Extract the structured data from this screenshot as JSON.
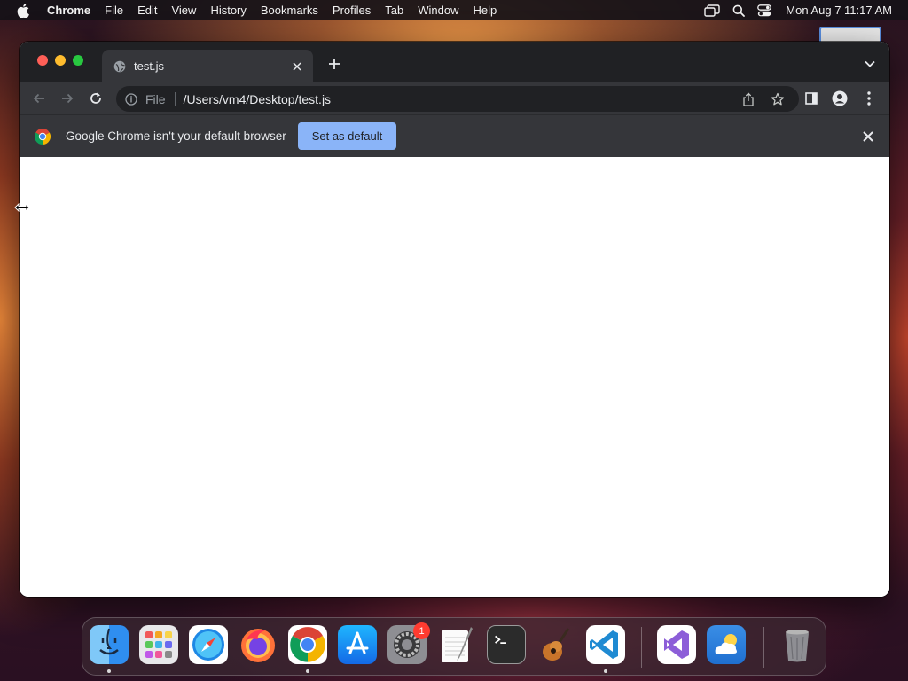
{
  "menubar": {
    "apple_icon": "apple-logo-icon",
    "items": [
      "Chrome",
      "File",
      "Edit",
      "View",
      "History",
      "Bookmarks",
      "Profiles",
      "Tab",
      "Window",
      "Help"
    ],
    "right_icons": [
      "screen-mirroring-icon",
      "search-icon",
      "control-center-icon"
    ],
    "clock": "Mon Aug 7  11:17 AM"
  },
  "browser": {
    "tab": {
      "title": "test.js",
      "favicon": "globe-icon"
    },
    "omnibox": {
      "scheme": "File",
      "url": "/Users/vm4/Desktop/test.js"
    },
    "infobar": {
      "message": "Google Chrome isn't your default browser",
      "button_label": "Set as default"
    },
    "colors": {
      "titlebar": "#202124",
      "toolbar": "#35363a",
      "accent_button": "#8ab4f8",
      "content": "#ffffff"
    }
  },
  "dock": {
    "apps": [
      {
        "name": "Finder",
        "icon": "finder-icon",
        "running": true
      },
      {
        "name": "Launchpad",
        "icon": "launchpad-icon",
        "running": false
      },
      {
        "name": "Safari",
        "icon": "safari-icon",
        "running": false
      },
      {
        "name": "Firefox",
        "icon": "firefox-icon",
        "running": false
      },
      {
        "name": "Google Chrome",
        "icon": "chrome-icon",
        "running": true
      },
      {
        "name": "App Store",
        "icon": "app-store-icon",
        "running": false
      },
      {
        "name": "System Settings",
        "icon": "system-settings-icon",
        "running": false,
        "badge": "1"
      },
      {
        "name": "TextEdit",
        "icon": "textedit-icon",
        "running": false
      },
      {
        "name": "Terminal",
        "icon": "terminal-icon",
        "running": false
      },
      {
        "name": "GarageBand",
        "icon": "garageband-icon",
        "running": false
      },
      {
        "name": "Visual Studio Code",
        "icon": "vscode-icon",
        "running": true
      },
      {
        "name": "Visual Studio",
        "icon": "visual-studio-icon",
        "running": false
      },
      {
        "name": "Weather",
        "icon": "weather-icon",
        "running": false
      },
      {
        "name": "Trash",
        "icon": "trash-icon",
        "running": false
      }
    ]
  }
}
